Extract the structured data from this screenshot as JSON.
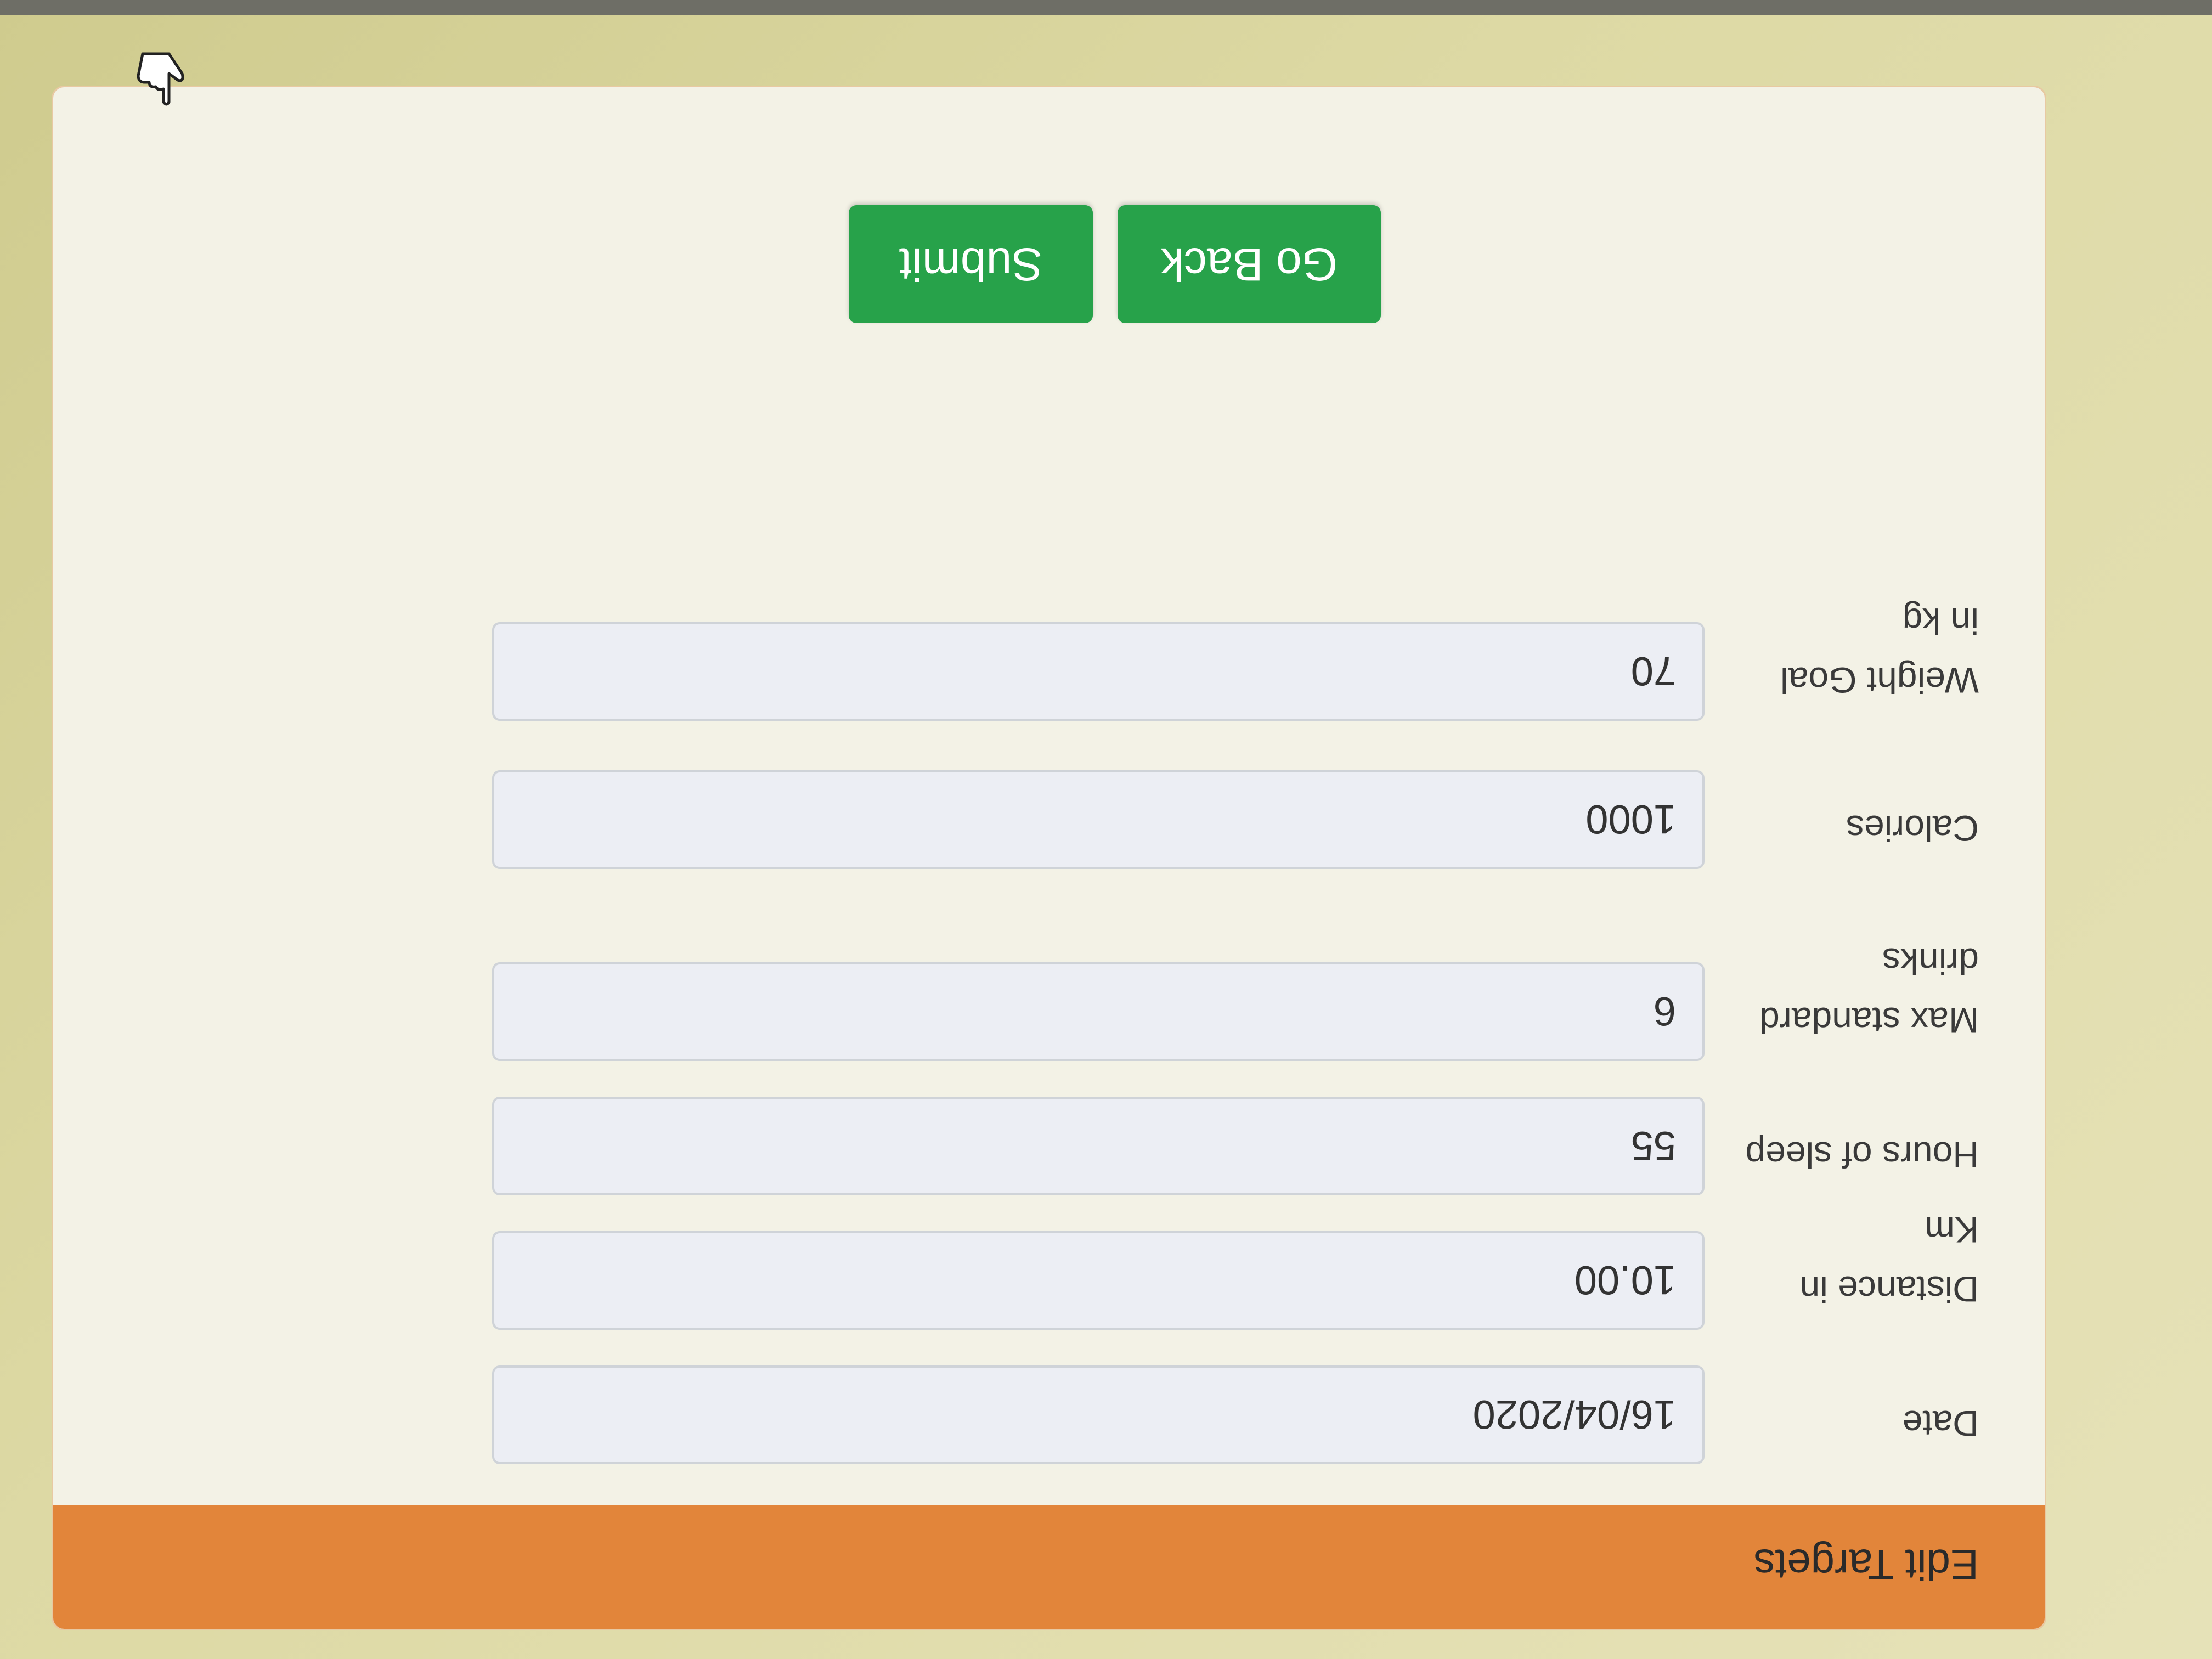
{
  "form": {
    "title": "Edit Targets",
    "fields": [
      {
        "label": "Date",
        "value": "16/04/2020"
      },
      {
        "label": "Distance in Km",
        "value": "10.00"
      },
      {
        "label": "Hours of sleep",
        "value": "55"
      },
      {
        "label": "Max standard drinks",
        "value": "6"
      },
      {
        "label": "Calories",
        "value": "1000"
      },
      {
        "label": "Weight Goal in kg",
        "value": "70"
      }
    ],
    "buttons": {
      "go_back": "Go Back",
      "submit": "Submit"
    }
  },
  "theme": {
    "header_color": "#e2853a",
    "button_color": "#27a24a",
    "card_color": "#f3f2e6"
  },
  "icons": {
    "cursor": "hand-pointer-icon"
  }
}
